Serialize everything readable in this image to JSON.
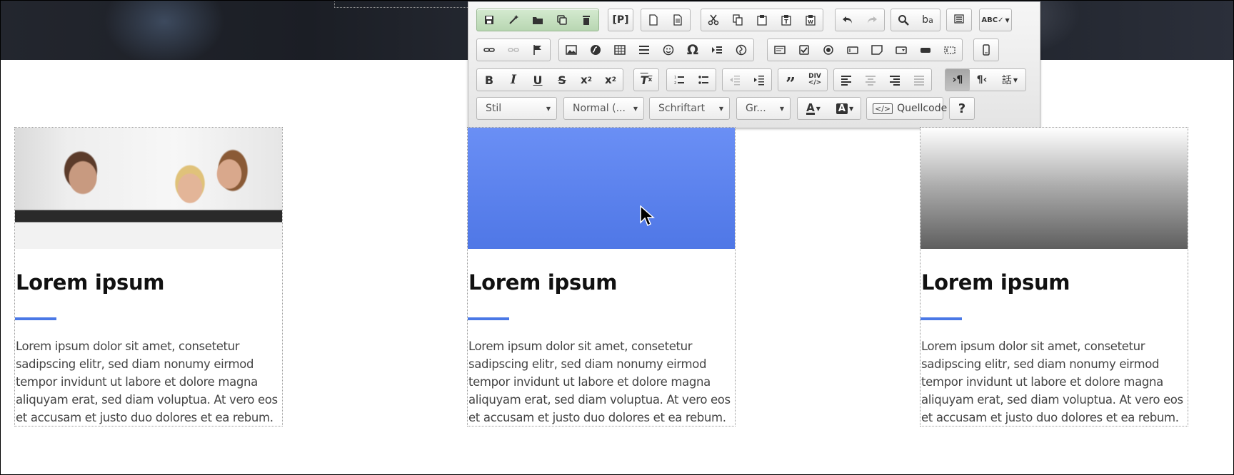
{
  "toolbar": {
    "combos": {
      "style": "Stil",
      "format": "Normal (...",
      "font": "Schriftart",
      "size": "Gr..."
    },
    "source_label": "Quellcode",
    "help_label": "?"
  },
  "cards": [
    {
      "title": "Lorem ipsum",
      "text": "Lorem ipsum dolor sit amet, consetetur sadipscing elitr, sed diam nonumy eirmod tempor invidunt ut labore et dolore magna aliquyam erat, sed diam voluptua. At vero eos et accusam et justo duo dolores et ea rebum."
    },
    {
      "title": "Lorem ipsum",
      "text": "Lorem ipsum dolor sit amet, consetetur sadipscing elitr, sed diam nonumy eirmod tempor invidunt ut labore et dolore magna aliquyam erat, sed diam voluptua. At vero eos et accusam et justo duo dolores et ea rebum."
    },
    {
      "title": "Lorem ipsum",
      "text": "Lorem ipsum dolor sit amet, consetetur sadipscing elitr, sed diam nonumy eirmod tempor invidunt ut labore et dolore magna aliquyam erat, sed diam voluptua. At vero eos et accusam et justo duo dolores et ea rebum."
    }
  ],
  "colors": {
    "accent": "#4a78e6",
    "blue_image": "#5b82ee"
  }
}
